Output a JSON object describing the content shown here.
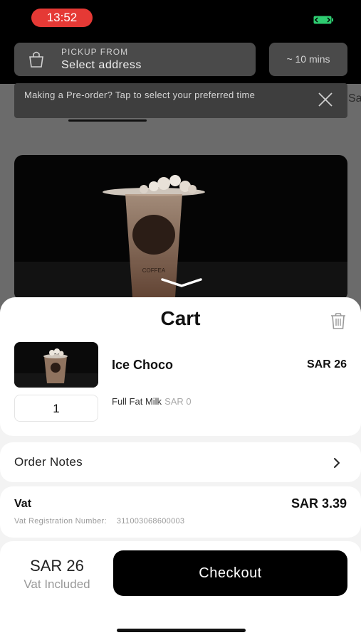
{
  "status_bar": {
    "time": "13:52"
  },
  "pickup": {
    "label": "PICKUP FROM",
    "value": "Select address",
    "eta": "~ 10 mins"
  },
  "banner": {
    "text": "Making a Pre-order? Tap to select your preferred time"
  },
  "background": {
    "edge_text": "Sa"
  },
  "hero": {
    "cup_brand": "COFFEA"
  },
  "cart": {
    "title": "Cart",
    "item": {
      "name": "Ice Choco",
      "price": "SAR 26",
      "quantity": "1",
      "modifier": "Full Fat Milk",
      "modifier_price": "SAR 0"
    },
    "order_notes_label": "Order Notes",
    "vat": {
      "label": "Vat",
      "value": "SAR 3.39",
      "reg_label": "Vat Registration Number:",
      "reg_number": "311003068600003"
    },
    "total": {
      "amount": "SAR 26",
      "sub": "Vat Included",
      "checkout_label": "Checkout"
    }
  },
  "colors": {
    "status_pill": "#e53935",
    "battery": "#2ecc71",
    "checkout_bg": "#000000"
  },
  "icons": [
    "battery-icon",
    "bag-icon",
    "close-icon",
    "chevron-down-icon",
    "trash-icon",
    "chevron-right-icon"
  ]
}
